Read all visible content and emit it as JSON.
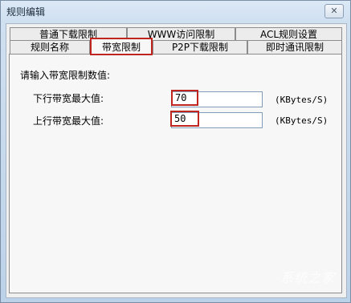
{
  "window": {
    "title": "规则编辑",
    "close_glyph": "✕"
  },
  "tabs_back": [
    {
      "label": "普通下载限制"
    },
    {
      "label": "WWW访问限制"
    },
    {
      "label": "ACL规则设置"
    }
  ],
  "tabs_front": [
    {
      "label": "规则名称"
    },
    {
      "label": "带宽限制"
    },
    {
      "label": "P2P下载限制"
    },
    {
      "label": "即时通讯限制"
    }
  ],
  "active_tab": "带宽限制",
  "panel": {
    "heading": "请输入带宽限制数值:",
    "download": {
      "label": "下行带宽最大值:",
      "value": "70",
      "unit": "(KBytes/S)"
    },
    "upload": {
      "label": "上行带宽最大值:",
      "value": "50",
      "unit": "(KBytes/S)"
    }
  },
  "highlight_color": "#c0241f",
  "watermark": "系统之家"
}
